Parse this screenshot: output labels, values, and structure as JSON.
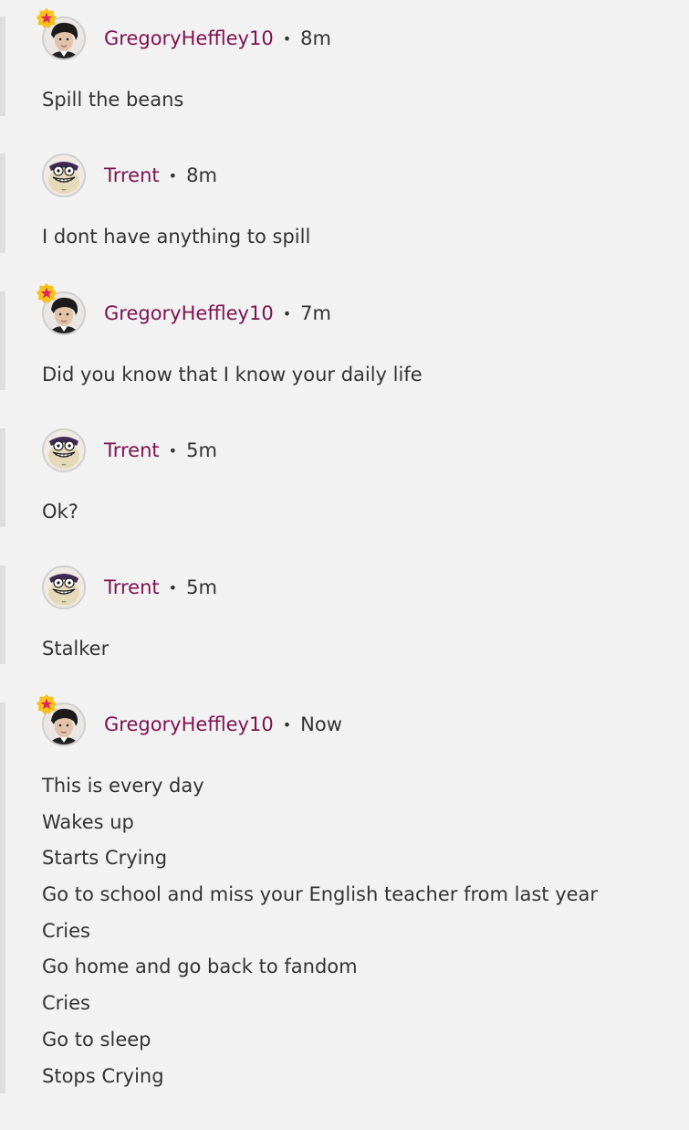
{
  "comments": [
    {
      "author": "GregoryHeffley10",
      "separator": "•",
      "time": "8m",
      "avatar": "gregory-avatar",
      "badge": "star-badge-icon",
      "lines": [
        "Spill the beans"
      ]
    },
    {
      "author": "Trrent",
      "separator": "•",
      "time": "8m",
      "avatar": "trent-avatar",
      "lines": [
        "I dont have anything to spill"
      ]
    },
    {
      "author": "GregoryHeffley10",
      "separator": "•",
      "time": "7m",
      "avatar": "gregory-avatar",
      "badge": "star-badge-icon",
      "lines": [
        "Did you know that I know your daily life"
      ]
    },
    {
      "author": "Trrent",
      "separator": "•",
      "time": "5m",
      "avatar": "trent-avatar",
      "lines": [
        "Ok?"
      ]
    },
    {
      "author": "Trrent",
      "separator": "•",
      "time": "5m",
      "avatar": "trent-avatar",
      "lines": [
        "Stalker"
      ]
    },
    {
      "author": "GregoryHeffley10",
      "separator": "•",
      "time": "Now",
      "avatar": "gregory-avatar",
      "badge": "star-badge-icon",
      "lines": [
        "This is every day",
        "Wakes up",
        "Starts Crying",
        "Go to school and miss your English teacher from last year",
        "Cries",
        "Go home and go back to fandom",
        "Cries",
        "Go to sleep",
        "Stops Crying"
      ]
    }
  ],
  "colors": {
    "background": "#f2f2f2",
    "username": "#7d1250",
    "text": "#333333",
    "rail": "#dedede",
    "badge_fill": "#f7c21a",
    "badge_star": "#e0245e"
  }
}
